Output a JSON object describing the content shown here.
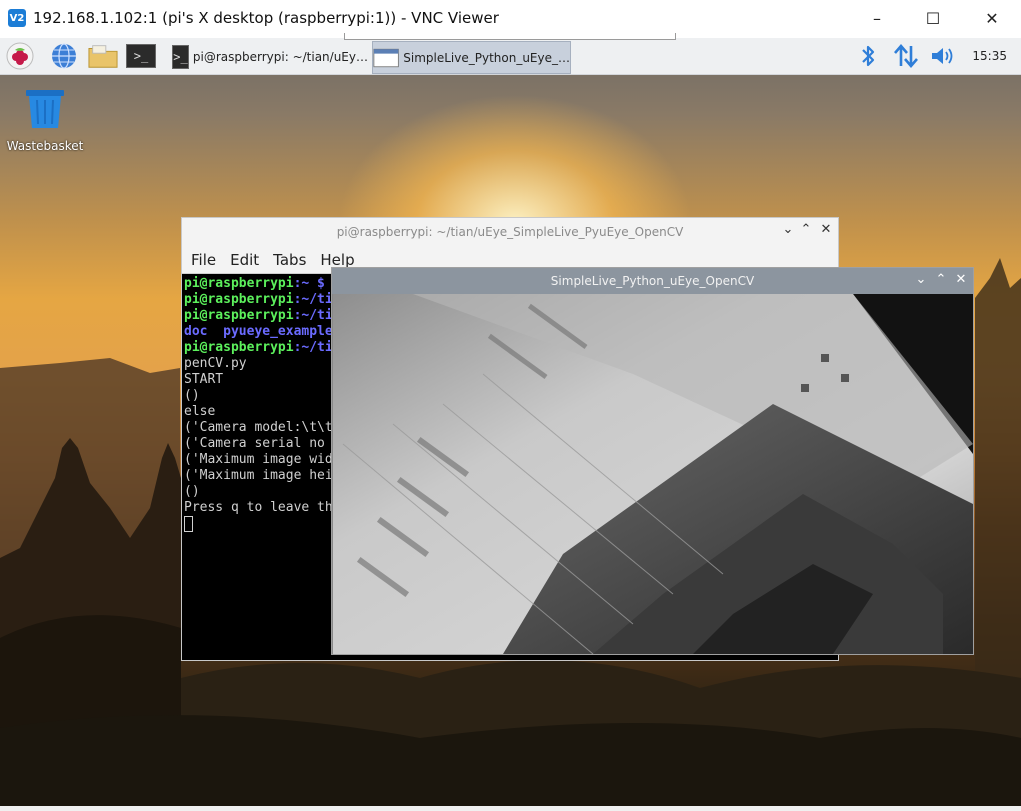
{
  "vnc": {
    "logo": "V2",
    "title": "192.168.1.102:1 (pi's X desktop (raspberrypi:1)) - VNC Viewer",
    "minimize": "–",
    "maximize": "☐",
    "close": "✕"
  },
  "taskbar": {
    "tasks": [
      {
        "label": "pi@raspberrypi: ~/tian/uEy…",
        "active": false
      },
      {
        "label": "SimpleLive_Python_uEye_…",
        "active": true
      }
    ],
    "clock": "15:35",
    "terminal_glyph": ">_"
  },
  "desktop": {
    "wastebasket_label": "Wastebasket"
  },
  "terminal": {
    "title": "pi@raspberrypi: ~/tian/uEye_SimpleLive_PyuEye_OpenCV",
    "menu": [
      "File",
      "Edit",
      "Tabs",
      "Help"
    ],
    "lines": [
      [
        {
          "text": "pi@raspberrypi",
          "cls": "t-green"
        },
        {
          "text": ":~ $",
          "cls": "t-blue"
        }
      ],
      [
        {
          "text": "pi@raspberrypi",
          "cls": "t-green"
        },
        {
          "text": ":~/ti",
          "cls": "t-blue"
        }
      ],
      [
        {
          "text": "pi@raspberrypi",
          "cls": "t-green"
        },
        {
          "text": ":~/ti",
          "cls": "t-blue"
        }
      ],
      [
        {
          "text": "doc  pyueye_example",
          "cls": "t-blue"
        }
      ],
      [
        {
          "text": "pi@raspberrypi",
          "cls": "t-green"
        },
        {
          "text": ":~/ti",
          "cls": "t-blue"
        }
      ],
      [
        {
          "text": "penCV.py",
          "cls": "t-dim"
        }
      ],
      [
        {
          "text": "START",
          "cls": "t-dim"
        }
      ],
      [
        {
          "text": "()",
          "cls": "t-dim"
        }
      ],
      [
        {
          "text": "else",
          "cls": "t-dim"
        }
      ],
      [
        {
          "text": "('Camera model:\\t\\t",
          "cls": "t-dim"
        }
      ],
      [
        {
          "text": "('Camera serial no",
          "cls": "t-dim"
        }
      ],
      [
        {
          "text": "('Maximum image wid",
          "cls": "t-dim"
        }
      ],
      [
        {
          "text": "('Maximum image hei",
          "cls": "t-dim"
        }
      ],
      [
        {
          "text": "()",
          "cls": "t-dim"
        }
      ],
      [
        {
          "text": "Press q to leave th",
          "cls": "t-dim"
        }
      ]
    ],
    "controls": {
      "menu": "⌄",
      "restore": "⌃",
      "close": "✕"
    }
  },
  "camera": {
    "title": "SimpleLive_Python_uEye_OpenCV",
    "controls": {
      "menu": "⌄",
      "restore": "⌃",
      "close": "✕"
    }
  }
}
